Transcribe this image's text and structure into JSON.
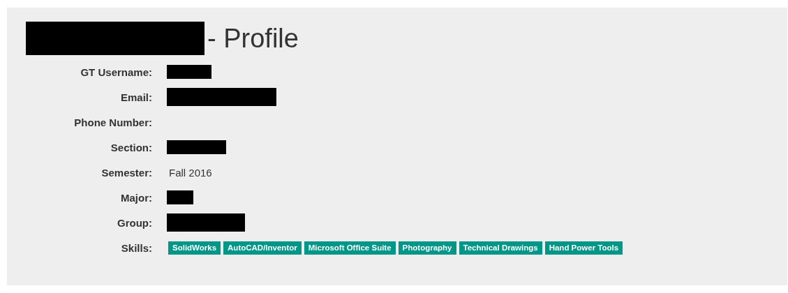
{
  "heading": {
    "name_redacted": true,
    "suffix": "- Profile"
  },
  "fields": [
    {
      "label": "GT Username:",
      "kind": "redacted"
    },
    {
      "label": "Email:",
      "kind": "redacted"
    },
    {
      "label": "Phone Number:",
      "kind": "empty"
    },
    {
      "label": "Section:",
      "kind": "redacted"
    },
    {
      "label": "Semester:",
      "kind": "text",
      "value": "Fall 2016"
    },
    {
      "label": "Major:",
      "kind": "redacted"
    },
    {
      "label": "Group:",
      "kind": "redacted"
    },
    {
      "label": "Skills:",
      "kind": "tags",
      "tags": [
        "SolidWorks",
        "AutoCAD/Inventor",
        "Microsoft Office Suite",
        "Photography",
        "Technical Drawings",
        "Hand Power Tools"
      ]
    }
  ]
}
